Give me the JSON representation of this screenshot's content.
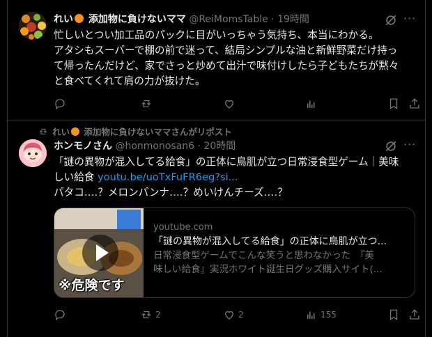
{
  "tweet1": {
    "name_prefix": "れい",
    "name_suffix": "添加物に負けないママ",
    "handle": "@ReiMomsTable",
    "time": "19時間",
    "body_lines": [
      "忙しいとつい加工品のパックに目がいっちゃう気持ち、本当にわかる。",
      "アタシもスーパーで棚の前で迷って、結局シンプルな油と新鮮野菜だけ持っ",
      "て帰ったんだけど、家でさっと炒めて出汁で味付けしたら子どもたちが黙々",
      "と食べてくれて肩の力が抜けた。"
    ],
    "actions": {
      "reply": "",
      "repost": "",
      "like": "",
      "views": ""
    }
  },
  "tweet2": {
    "repost_prefix": "れい",
    "repost_suffix": "添加物に負けないママさんがリポスト",
    "name": "ホンモノさん",
    "handle": "@honmonosan6",
    "time": "20時間",
    "body_line1": "「謎の異物が混入してる給食」の正体に鳥肌が立つ日常浸食型ゲーム｜美味",
    "body_line2_text": "しい給食 ",
    "body_link": "youtu.be/uoTxFuFR6eg?si...",
    "body_line3": "パタコ‥‥？メロンパンナ‥‥？めいけんチーズ‥‥？",
    "card": {
      "domain": "youtube.com",
      "title": "「謎の異物が混入してる給食」の正体に鳥肌が立つ...",
      "desc_line1": "日常浸食型ゲームでこんな笑うと思わなかった　『美",
      "desc_line2": "味しい給食』実況ホワイト誕生日グッズ購入サイト(...",
      "thumb_caption": "※危険です"
    },
    "actions": {
      "reply": "",
      "repost": "2",
      "like": "2",
      "views": "155"
    }
  },
  "colors": {
    "bg": "#000000",
    "text": "#e7e9ea",
    "muted": "#71767b",
    "link": "#1d9bf0",
    "border": "#2f3336"
  },
  "icons": [
    "grok-icon",
    "more-icon",
    "reply-icon",
    "repost-icon",
    "like-icon",
    "views-icon",
    "bookmark-icon",
    "share-icon",
    "orange-emoji-icon",
    "play-icon"
  ]
}
